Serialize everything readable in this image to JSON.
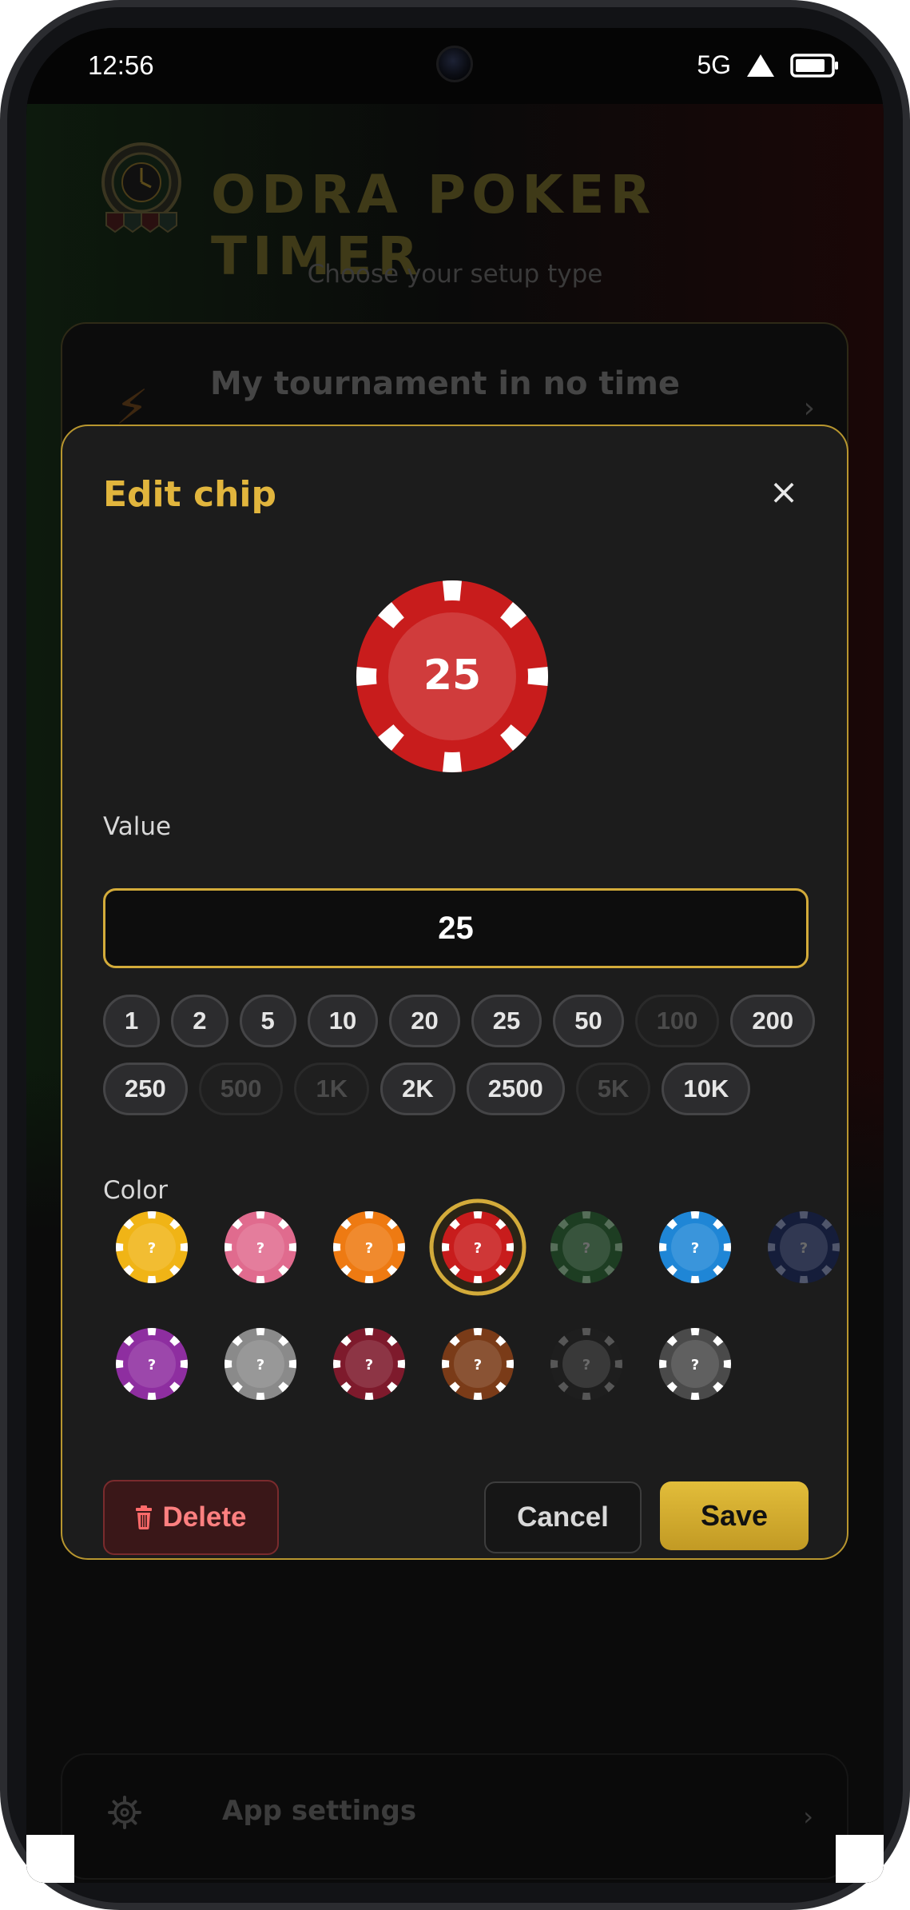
{
  "status_bar": {
    "time": "12:56",
    "network": "5G"
  },
  "background_app": {
    "title": "ODRA POKER TIMER",
    "subtitle": "Choose your setup type",
    "card": {
      "title": "My tournament in no time"
    },
    "settings": {
      "label": "App settings"
    }
  },
  "modal": {
    "title": "Edit chip",
    "close_label": "×",
    "preview": {
      "value_label": "25",
      "color": "#c81c1c"
    },
    "value_label": "Value",
    "value_input": "25",
    "presets": {
      "rows": [
        [
          {
            "label": "1",
            "enabled": true
          },
          {
            "label": "2",
            "enabled": true
          },
          {
            "label": "5",
            "enabled": true
          },
          {
            "label": "10",
            "enabled": true
          },
          {
            "label": "20",
            "enabled": true
          },
          {
            "label": "25",
            "enabled": true
          },
          {
            "label": "50",
            "enabled": true
          },
          {
            "label": "100",
            "enabled": false
          },
          {
            "label": "200",
            "enabled": true
          }
        ],
        [
          {
            "label": "250",
            "enabled": true
          },
          {
            "label": "500",
            "enabled": false
          },
          {
            "label": "1K",
            "enabled": false
          },
          {
            "label": "2K",
            "enabled": true
          },
          {
            "label": "2500",
            "enabled": true
          },
          {
            "label": "5K",
            "enabled": false
          },
          {
            "label": "10K",
            "enabled": true
          }
        ]
      ]
    },
    "color_label": "Color",
    "colors": [
      {
        "name": "yellow",
        "hex": "#f0b416",
        "selected": false,
        "dim": false
      },
      {
        "name": "pink",
        "hex": "#e06b8e",
        "selected": false,
        "dim": false
      },
      {
        "name": "orange",
        "hex": "#ee7a12",
        "selected": false,
        "dim": false
      },
      {
        "name": "red",
        "hex": "#c81c1c",
        "selected": true,
        "dim": false
      },
      {
        "name": "dark-green",
        "hex": "#1d3d22",
        "selected": false,
        "dim": true
      },
      {
        "name": "blue",
        "hex": "#1f86d6",
        "selected": false,
        "dim": false
      },
      {
        "name": "navy",
        "hex": "#151d3a",
        "selected": false,
        "dim": true
      },
      {
        "name": "purple",
        "hex": "#8e2ea0",
        "selected": false,
        "dim": false
      },
      {
        "name": "gray",
        "hex": "#8a8a8a",
        "selected": false,
        "dim": false
      },
      {
        "name": "burgundy",
        "hex": "#7e1a2c",
        "selected": false,
        "dim": false
      },
      {
        "name": "brown",
        "hex": "#7a3b18",
        "selected": false,
        "dim": false
      },
      {
        "name": "black",
        "hex": "#1e1e1e",
        "selected": false,
        "dim": true
      },
      {
        "name": "charcoal",
        "hex": "#4a4a4a",
        "selected": false,
        "dim": false
      }
    ],
    "chip_mark": "?",
    "actions": {
      "delete_label": "Delete",
      "cancel_label": "Cancel",
      "save_label": "Save"
    }
  }
}
